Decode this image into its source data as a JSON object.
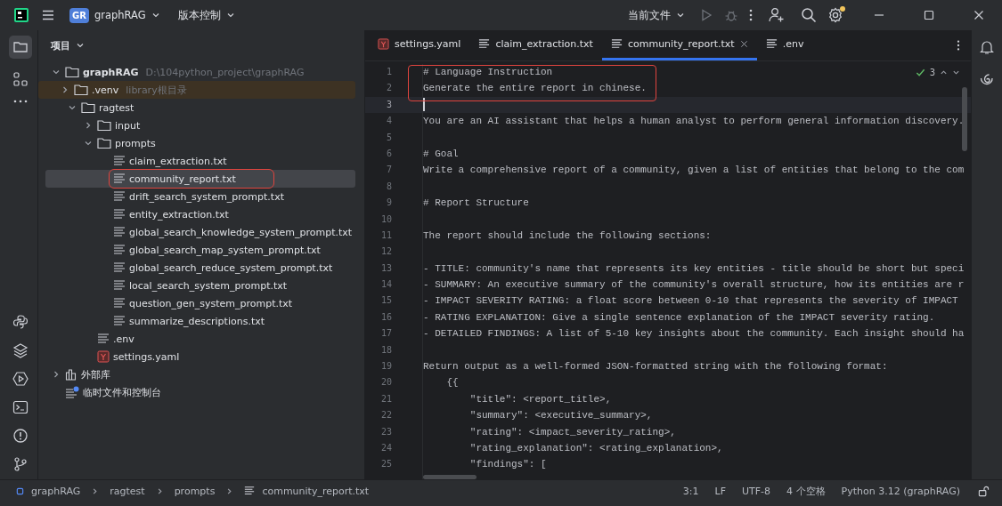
{
  "title_bar": {
    "project_badge": "GR",
    "project": "graphRAG",
    "vcs": "版本控制",
    "run_config": "当前文件"
  },
  "project_panel": {
    "title": "项目",
    "tree": [
      {
        "name": "graphRAG",
        "hint": "D:\\104python_project\\graphRAG",
        "kind": "folder",
        "expanded": true,
        "selected": false,
        "boxed": false,
        "excluded": false,
        "children": [
          {
            "name": ".venv",
            "hint": "library根目录",
            "kind": "folder",
            "expanded": false,
            "selected": false,
            "boxed": false,
            "excluded": true
          },
          {
            "name": "ragtest",
            "kind": "folder",
            "expanded": true,
            "selected": false,
            "boxed": false,
            "excluded": false,
            "children": [
              {
                "name": "input",
                "kind": "folder",
                "expanded": false,
                "selected": false,
                "boxed": false,
                "excluded": false
              },
              {
                "name": "prompts",
                "kind": "folder",
                "expanded": true,
                "selected": false,
                "boxed": false,
                "excluded": false,
                "children": [
                  {
                    "name": "claim_extraction.txt",
                    "kind": "file",
                    "selected": false,
                    "boxed": false,
                    "excluded": false
                  },
                  {
                    "name": "community_report.txt",
                    "kind": "file",
                    "selected": true,
                    "boxed": true,
                    "excluded": false
                  },
                  {
                    "name": "drift_search_system_prompt.txt",
                    "kind": "file",
                    "selected": false,
                    "boxed": false,
                    "excluded": false
                  },
                  {
                    "name": "entity_extraction.txt",
                    "kind": "file",
                    "selected": false,
                    "boxed": false,
                    "excluded": false
                  },
                  {
                    "name": "global_search_knowledge_system_prompt.txt",
                    "kind": "file",
                    "selected": false,
                    "boxed": false,
                    "excluded": false
                  },
                  {
                    "name": "global_search_map_system_prompt.txt",
                    "kind": "file",
                    "selected": false,
                    "boxed": false,
                    "excluded": false
                  },
                  {
                    "name": "global_search_reduce_system_prompt.txt",
                    "kind": "file",
                    "selected": false,
                    "boxed": false,
                    "excluded": false
                  },
                  {
                    "name": "local_search_system_prompt.txt",
                    "kind": "file",
                    "selected": false,
                    "boxed": false,
                    "excluded": false
                  },
                  {
                    "name": "question_gen_system_prompt.txt",
                    "kind": "file",
                    "selected": false,
                    "boxed": false,
                    "excluded": false
                  },
                  {
                    "name": "summarize_descriptions.txt",
                    "kind": "file",
                    "selected": false,
                    "boxed": false,
                    "excluded": false
                  }
                ]
              },
              {
                "name": ".env",
                "kind": "file",
                "selected": false,
                "boxed": false,
                "excluded": false
              },
              {
                "name": "settings.yaml",
                "kind": "yaml",
                "selected": false,
                "boxed": false,
                "excluded": false
              }
            ]
          }
        ]
      },
      {
        "name": "外部库",
        "kind": "library",
        "expanded": false,
        "selected": false,
        "boxed": false,
        "excluded": false
      },
      {
        "name": "临时文件和控制台",
        "kind": "scratch",
        "selected": false,
        "boxed": false,
        "excluded": false
      }
    ]
  },
  "tabs": [
    {
      "label": "settings.yaml",
      "kind": "yaml",
      "selected": false
    },
    {
      "label": "claim_extraction.txt",
      "kind": "file",
      "selected": false
    },
    {
      "label": "community_report.txt",
      "kind": "file",
      "selected": true
    },
    {
      "label": ".env",
      "kind": "file",
      "selected": false
    }
  ],
  "editor": {
    "problems": "3",
    "lines": [
      {
        "n": "1",
        "text": "# Language Instruction",
        "current": false,
        "boxed": true
      },
      {
        "n": "2",
        "text": "Generate the entire report in chinese.",
        "current": false,
        "boxed": true
      },
      {
        "n": "3",
        "current": true
      },
      {
        "n": "4",
        "text": "You are an AI assistant that helps a human analyst to perform general information discovery.",
        "current": false
      },
      {
        "n": "5",
        "current": false
      },
      {
        "n": "6",
        "text": "# Goal",
        "current": false
      },
      {
        "n": "7",
        "text": "Write a comprehensive report of a community, given a list of entities that belong to the com",
        "current": false
      },
      {
        "n": "8",
        "current": false
      },
      {
        "n": "9",
        "text": "# Report Structure",
        "current": false
      },
      {
        "n": "10",
        "current": false
      },
      {
        "n": "11",
        "text": "The report should include the following sections:",
        "current": false
      },
      {
        "n": "12",
        "current": false
      },
      {
        "n": "13",
        "text": "- TITLE: community's name that represents its key entities - title should be short but speci",
        "current": false
      },
      {
        "n": "14",
        "text": "- SUMMARY: An executive summary of the community's overall structure, how its entities are r",
        "current": false
      },
      {
        "n": "15",
        "text": "- IMPACT SEVERITY RATING: a float score between 0-10 that represents the severity of IMPACT",
        "current": false
      },
      {
        "n": "16",
        "text": "- RATING EXPLANATION: Give a single sentence explanation of the IMPACT severity rating.",
        "current": false
      },
      {
        "n": "17",
        "text": "- DETAILED FINDINGS: A list of 5-10 key insights about the community. Each insight should ha",
        "current": false
      },
      {
        "n": "18",
        "current": false
      },
      {
        "n": "19",
        "text": "Return output as a well-formed JSON-formatted string with the following format:",
        "current": false
      },
      {
        "n": "20",
        "text": "    {{",
        "current": false
      },
      {
        "n": "21",
        "text": "        \"title\": <report_title>,",
        "current": false
      },
      {
        "n": "22",
        "text": "        \"summary\": <executive_summary>,",
        "current": false
      },
      {
        "n": "23",
        "text": "        \"rating\": <impact_severity_rating>,",
        "current": false
      },
      {
        "n": "24",
        "text": "        \"rating_explanation\": <rating_explanation>,",
        "current": false
      },
      {
        "n": "25",
        "text": "        \"findings\": [",
        "current": false
      }
    ]
  },
  "status_bar": {
    "breadcrumbs": [
      "graphRAG",
      "ragtest",
      "prompts",
      "community_report.txt"
    ],
    "items": [
      "3:1",
      "LF",
      "UTF-8",
      "4 个空格",
      "Python 3.12 (graphRAG)"
    ]
  }
}
